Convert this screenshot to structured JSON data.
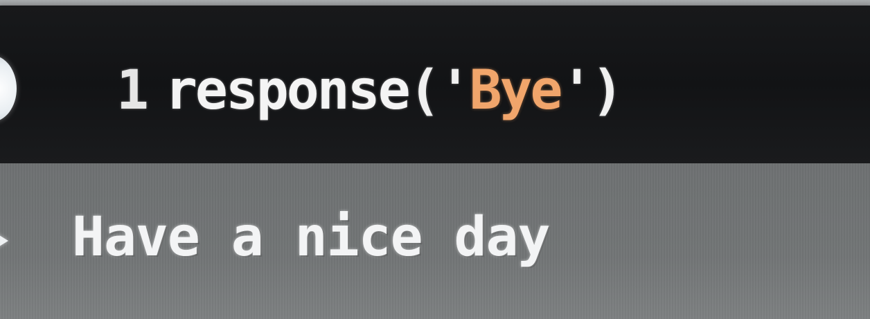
{
  "code_cell": {
    "line_number": "1",
    "function_name": "response",
    "open_paren": "(",
    "quote_open": "'",
    "string_argument": "Bye",
    "quote_close": "'",
    "close_paren": ")"
  },
  "output": {
    "text": "Have a nice day"
  },
  "colors": {
    "string_literal": "#f1a56b",
    "code_background": "#141517",
    "output_background": "#727576"
  },
  "icons": {
    "run_button": "run-circle-icon",
    "output_indicator": "output-arrow-icon"
  }
}
